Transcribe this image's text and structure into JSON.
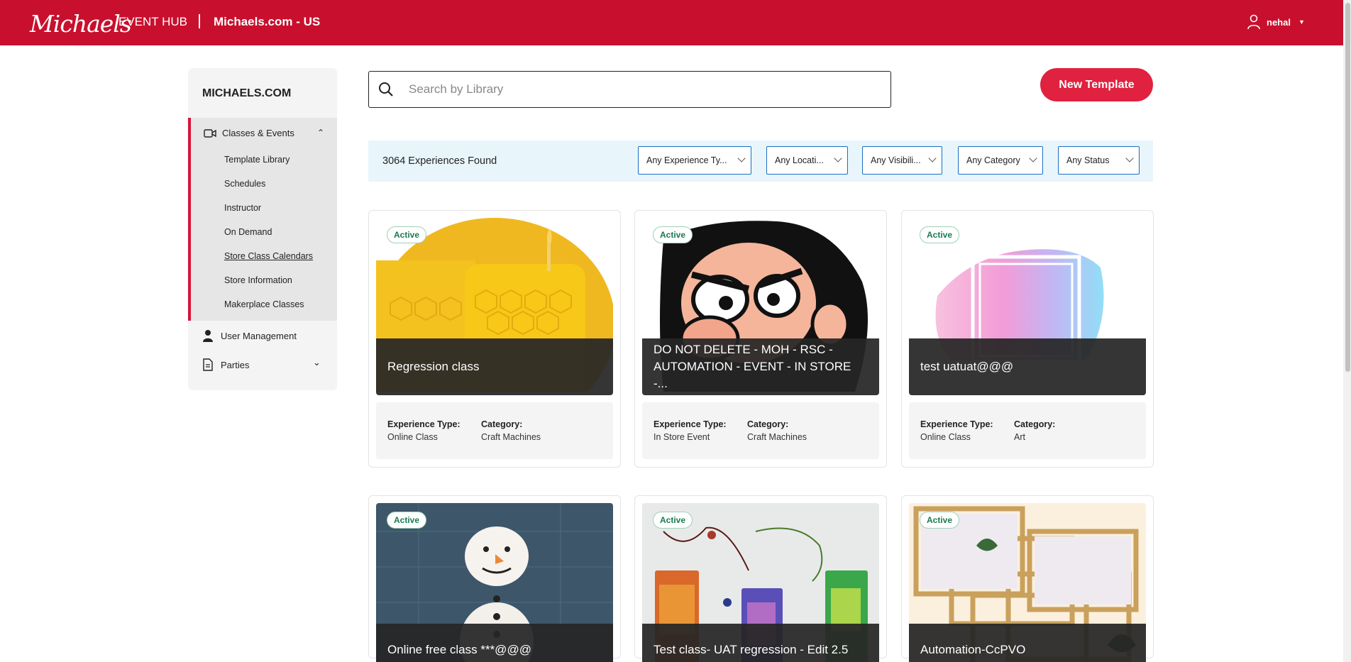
{
  "header": {
    "logo": "Michaels",
    "hub_label": "EVENT HUB",
    "site_label": "Michaels.com - US",
    "user_name": "nehal"
  },
  "sidebar": {
    "title": "MICHAELS.COM",
    "section": "Classes & Events",
    "sub_items": [
      "Template Library",
      "Schedules",
      "Instructor",
      "On Demand",
      "Store Class Calendars",
      "Store Information",
      "Makerplace Classes"
    ],
    "items": [
      {
        "label": "User Management"
      },
      {
        "label": "Parties"
      }
    ]
  },
  "search": {
    "placeholder": "Search by Library"
  },
  "new_template_label": "New Template",
  "filters": {
    "found_text": "3064 Experiences Found",
    "dropdowns": [
      "Any Experience Ty...",
      "Any Locati...",
      "Any Visibili...",
      "Any Category",
      "Any Status"
    ]
  },
  "labels": {
    "experience_type": "Experience Type:",
    "category": "Category:"
  },
  "cards": [
    {
      "status": "Active",
      "title": "Regression class",
      "experience_type": "Online Class",
      "category": "Craft Machines"
    },
    {
      "status": "Active",
      "title": "DO NOT DELETE - MOH - RSC - AUTOMATION - EVENT - IN STORE -...",
      "experience_type": "In Store Event",
      "category": "Craft Machines"
    },
    {
      "status": "Active",
      "title": "test uatuat@@@",
      "experience_type": "Online Class",
      "category": "Art"
    },
    {
      "status": "Active",
      "title": "Online free class ***@@@"
    },
    {
      "status": "Active",
      "title": "Test class- UAT regression - Edit 2.5"
    },
    {
      "status": "Active",
      "title": "Automation-CcPVO"
    }
  ],
  "colors": {
    "brand": "#c8102e",
    "button": "#e0213f",
    "filter_bg": "#e8f6fc",
    "active_badge": "#1a7a4f"
  }
}
